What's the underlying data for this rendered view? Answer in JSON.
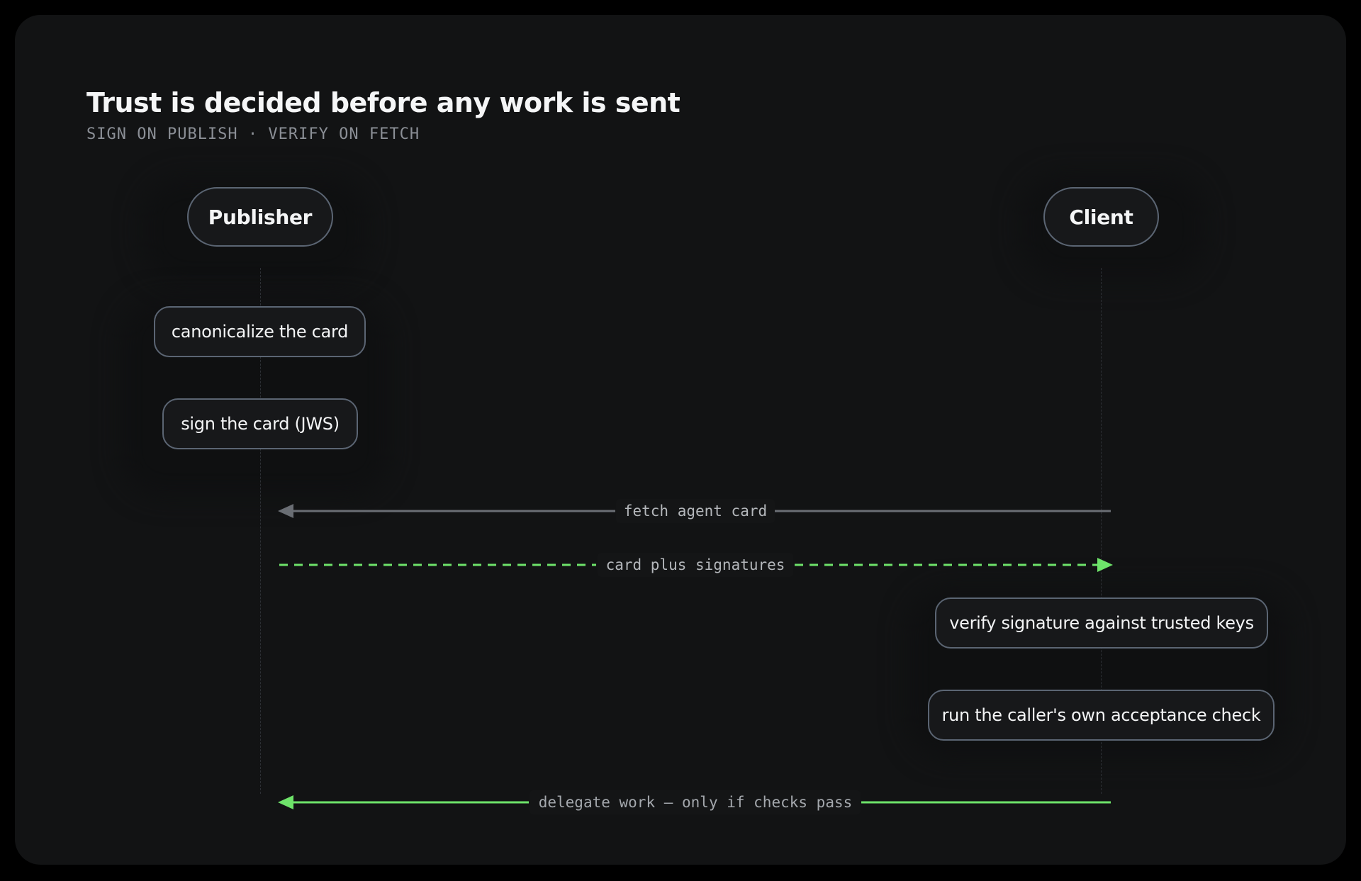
{
  "header": {
    "title": "Trust is decided before any work is sent",
    "subtitle": "SIGN ON PUBLISH · VERIFY ON FETCH"
  },
  "actors": {
    "publisher": "Publisher",
    "client": "Client"
  },
  "steps": {
    "canonicalize": "canonicalize the card",
    "sign": "sign the card (JWS)",
    "verify": "verify signature against trusted keys",
    "acceptance": "run the caller's own acceptance check"
  },
  "messages": {
    "fetch": "fetch agent card",
    "reply": "card plus signatures",
    "delegate": "delegate work — only if checks pass"
  },
  "colors": {
    "background": "#000000",
    "panel": "#121314",
    "accent_green": "#6ee36a",
    "neutral_arrow": "#6a6e74",
    "pill_border": "#5b6573"
  }
}
